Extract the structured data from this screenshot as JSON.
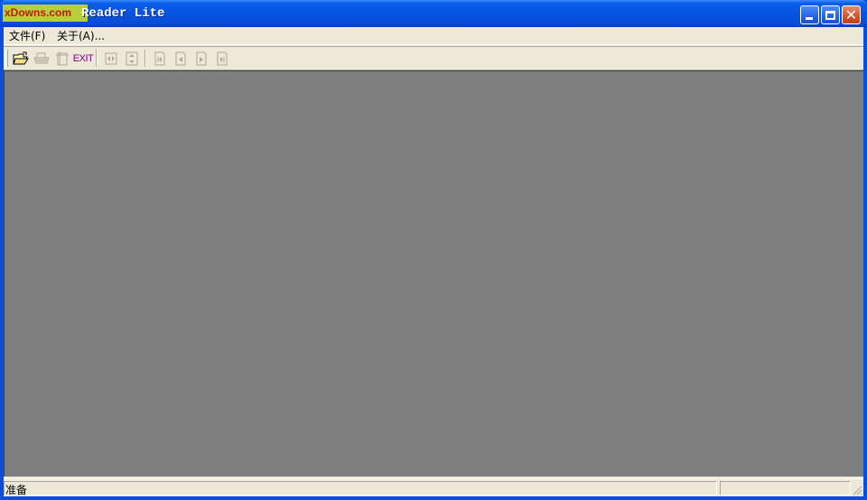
{
  "window": {
    "watermark": "xDowns.com",
    "title": "Reader Lite",
    "controls": {
      "minimize": "minimize",
      "maximize": "maximize",
      "close": "close"
    }
  },
  "menu": {
    "items": [
      {
        "label": "文件(F)"
      },
      {
        "label": "关于(A)..."
      }
    ]
  },
  "toolbar": {
    "buttons": [
      {
        "icon": "open-folder-icon",
        "enabled": true
      },
      {
        "icon": "print-icon",
        "enabled": false
      },
      {
        "icon": "page-setup-icon",
        "enabled": false
      },
      {
        "icon": "exit-icon",
        "label": "EXIT",
        "enabled": true
      },
      {
        "icon": "fit-width-icon",
        "enabled": false
      },
      {
        "icon": "fit-height-icon",
        "enabled": false
      },
      {
        "icon": "first-page-icon",
        "enabled": false
      },
      {
        "icon": "previous-page-icon",
        "enabled": false
      },
      {
        "icon": "next-page-icon",
        "enabled": false
      },
      {
        "icon": "last-page-icon",
        "enabled": false
      }
    ]
  },
  "status": {
    "text": "准备"
  },
  "colors": {
    "titlebar": "#0553e0",
    "chrome": "#ece9d8",
    "workspace": "#7f7f7f",
    "close_button": "#d9532d",
    "exit_label": "#800080"
  }
}
